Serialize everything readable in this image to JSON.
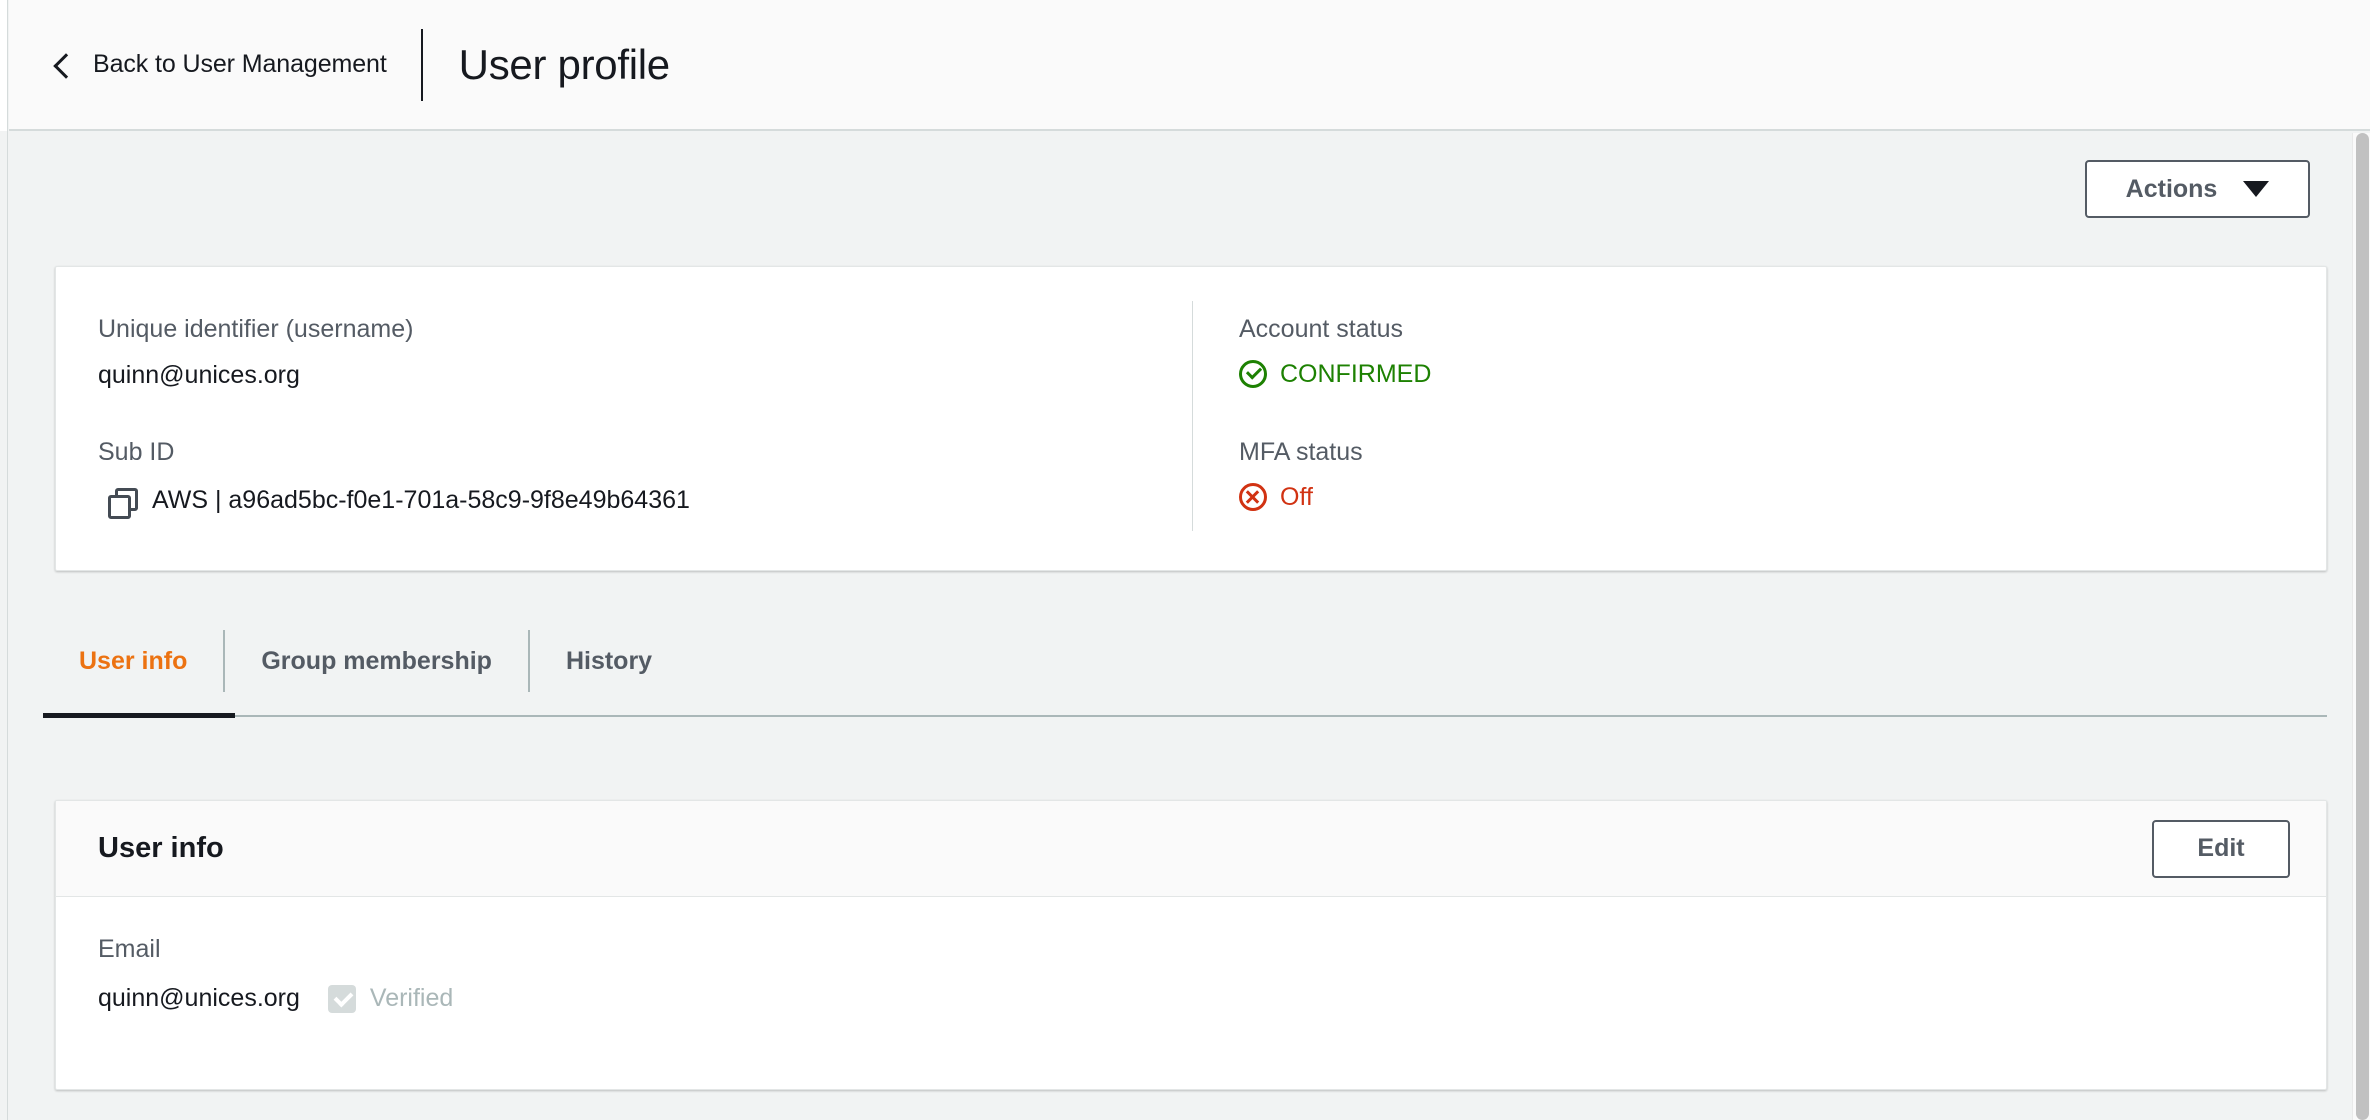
{
  "header": {
    "back_label": "Back to User Management",
    "back_icon": "chevron-left-icon",
    "title": "User profile"
  },
  "toolbar": {
    "actions_label": "Actions",
    "actions_caret_icon": "caret-down-icon"
  },
  "summary": {
    "left": [
      {
        "label": "Unique identifier (username)",
        "value": "quinn@unices.org"
      },
      {
        "label": "Sub ID",
        "value": "AWS | a96ad5bc-f0e1-701a-58c9-9f8e49b64361",
        "copy_icon": "copy-icon"
      }
    ],
    "right": [
      {
        "label": "Account status",
        "value": "CONFIRMED",
        "state": "success",
        "icon": "status-success-icon",
        "color": "#1d8102"
      },
      {
        "label": "MFA status",
        "value": "Off",
        "state": "error",
        "icon": "status-error-icon",
        "color": "#d13212"
      }
    ]
  },
  "tabs": {
    "active_index": 0,
    "items": [
      {
        "label": "User info"
      },
      {
        "label": "Group membership"
      },
      {
        "label": "History"
      }
    ],
    "active_color": "#ec7211"
  },
  "user_info_panel": {
    "title": "User info",
    "edit_label": "Edit",
    "fields": [
      {
        "label": "Email",
        "value": "quinn@unices.org",
        "verified_label": "Verified",
        "verified_checked": true
      }
    ]
  }
}
